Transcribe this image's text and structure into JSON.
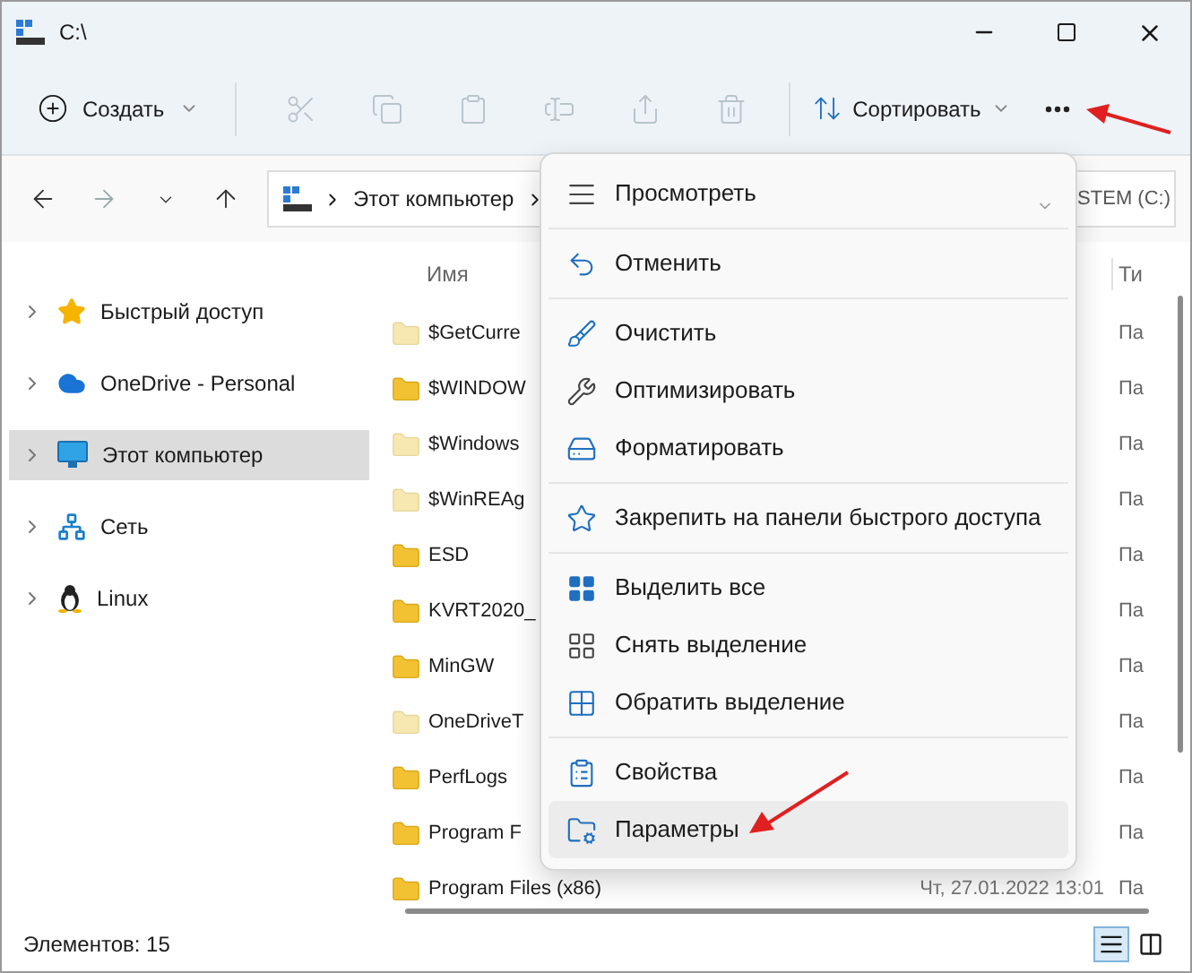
{
  "window": {
    "title": "C:\\"
  },
  "toolbar": {
    "new": {
      "label": "Создать"
    },
    "actions": [
      {
        "kind": "cut",
        "disabled": true
      },
      {
        "kind": "copy",
        "disabled": true
      },
      {
        "kind": "paste",
        "disabled": true
      },
      {
        "kind": "rename",
        "disabled": true
      },
      {
        "kind": "share",
        "disabled": true
      },
      {
        "kind": "delete",
        "disabled": true
      }
    ],
    "sort": {
      "label": "Сортировать"
    }
  },
  "navigation": [
    {
      "kind": "back",
      "disabled": false
    },
    {
      "kind": "forward",
      "disabled": true
    },
    {
      "kind": "recent",
      "disabled": false
    },
    {
      "kind": "up",
      "disabled": false
    }
  ],
  "address": {
    "segments": [
      "Этот компьютер"
    ]
  },
  "search": {
    "placeholder": "STEM (C:)"
  },
  "sidebar": {
    "items": [
      {
        "kind": "quick",
        "label": "Быстрый доступ",
        "selected": false,
        "expanded": false
      },
      {
        "kind": "cloud",
        "label": "OneDrive - Personal",
        "selected": false,
        "expanded": false
      },
      {
        "kind": "pc",
        "label": "Этот компьютер",
        "selected": true,
        "expanded": false
      },
      {
        "kind": "network",
        "label": "Сеть",
        "selected": false,
        "expanded": false
      },
      {
        "kind": "linux",
        "label": "Linux",
        "selected": false,
        "expanded": false
      }
    ]
  },
  "file_list": {
    "columns": [
      "Имя",
      "Ти"
    ],
    "rows": [
      {
        "name": "$GetCurre",
        "type": "Па",
        "hidden": true
      },
      {
        "name": "$WINDOW",
        "type": "Па",
        "hidden": false
      },
      {
        "name": "$Windows",
        "type": "Па",
        "hidden": true
      },
      {
        "name": "$WinREAg",
        "type": "Па",
        "hidden": true
      },
      {
        "name": "ESD",
        "type": "Па",
        "hidden": false
      },
      {
        "name": "KVRT2020_",
        "type": "Па",
        "hidden": false
      },
      {
        "name": "MinGW",
        "type": "Па",
        "hidden": false
      },
      {
        "name": "OneDriveT",
        "type": "Па",
        "hidden": true
      },
      {
        "name": "PerfLogs",
        "type": "Па",
        "hidden": false
      },
      {
        "name": "Program F",
        "type": "Па",
        "hidden": false
      },
      {
        "name": "Program Files (x86)",
        "modified": "Чт, 27.01.2022 13:01",
        "type": "Па",
        "hidden": false
      }
    ]
  },
  "menu": {
    "groups": [
      {
        "items": [
          {
            "kind": "view",
            "label": "Просмотреть",
            "submenu": true,
            "highlighted": false
          }
        ]
      },
      {
        "items": [
          {
            "kind": "undo",
            "label": "Отменить",
            "submenu": false,
            "highlighted": false
          }
        ]
      },
      {
        "items": [
          {
            "kind": "clean",
            "label": "Очистить",
            "submenu": false,
            "highlighted": false
          },
          {
            "kind": "optimize",
            "label": "Оптимизировать",
            "submenu": false,
            "highlighted": false
          },
          {
            "kind": "format",
            "label": "Форматировать",
            "submenu": false,
            "highlighted": false
          }
        ]
      },
      {
        "items": [
          {
            "kind": "pin",
            "label": "Закрепить на панели быстрого доступа",
            "submenu": false,
            "highlighted": false
          }
        ]
      },
      {
        "items": [
          {
            "kind": "select_all",
            "label": "Выделить все",
            "submenu": false,
            "highlighted": false
          },
          {
            "kind": "select_none",
            "label": "Снять выделение",
            "submenu": false,
            "highlighted": false
          },
          {
            "kind": "invert",
            "label": "Обратить выделение",
            "submenu": false,
            "highlighted": false
          }
        ]
      },
      {
        "items": [
          {
            "kind": "properties",
            "label": "Свойства",
            "submenu": false,
            "highlighted": false
          },
          {
            "kind": "options",
            "label": "Параметры",
            "submenu": false,
            "highlighted": true
          }
        ]
      }
    ]
  },
  "status_bar": {
    "count": "Элементов: 15",
    "view_buttons": [
      {
        "kind": "details",
        "selected": true
      },
      {
        "kind": "tiles",
        "selected": false
      }
    ]
  }
}
